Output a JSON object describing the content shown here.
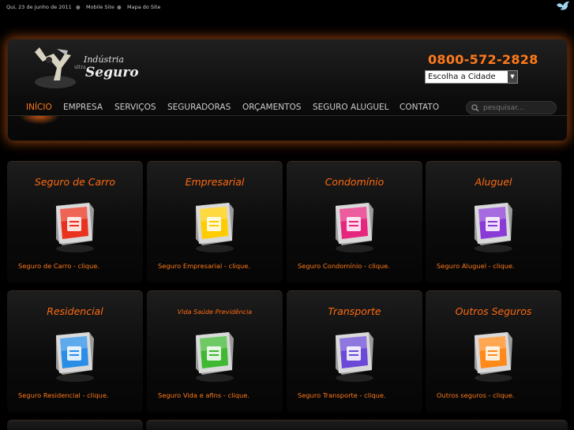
{
  "topbar": {
    "date": "Qui, 23 de Junho de 2011",
    "links": [
      "Mobile Site",
      "Mapa do Site"
    ]
  },
  "header": {
    "logo": {
      "line1": "Indústria",
      "small": "ultra",
      "line2": "Seguro"
    },
    "phone": "0800-572-2828",
    "city_select": "Escolha a Cidade",
    "search_placeholder": "pesquisar..."
  },
  "nav": [
    "INÍCIO",
    "EMPRESA",
    "SERVIÇOS",
    "SEGURADORAS",
    "ORÇAMENTOS",
    "SEGURO ALUGUEL",
    "CONTATO"
  ],
  "colors": {
    "accent": "#ff7a1a",
    "background": "#000000"
  },
  "tiles": [
    {
      "title": "Seguro de Carro",
      "link": "Seguro de Carro - clique.",
      "icon": "car-crash-icon",
      "color": "#e8321e"
    },
    {
      "title": "Empresarial",
      "link": "Seguro Empresarial - clique.",
      "icon": "chart-icon",
      "color": "#ffcc00"
    },
    {
      "title": "Condomínio",
      "link": "Seguro Condomínio - clique.",
      "icon": "buildings-icon",
      "color": "#e6267e"
    },
    {
      "title": "Aluguel",
      "link": "Seguro Aluguel - clique.",
      "icon": "document-icon",
      "color": "#8a3ad6"
    },
    {
      "title": "Residencial",
      "link": "Seguro Residencial - clique.",
      "icon": "house-icon",
      "color": "#2a8ee6"
    },
    {
      "title": "Vida Saúde Previdência",
      "link": "Seguro Vida e afins - clique.",
      "icon": "family-icon",
      "color": "#3fb832"
    },
    {
      "title": "Transporte",
      "link": "Seguro Transporte - clique.",
      "icon": "truck-icon",
      "color": "#6a4ad6"
    },
    {
      "title": "Outros Seguros",
      "link": "Outros seguros - clique.",
      "icon": "handshake-icon",
      "color": "#ff8a1a"
    }
  ]
}
